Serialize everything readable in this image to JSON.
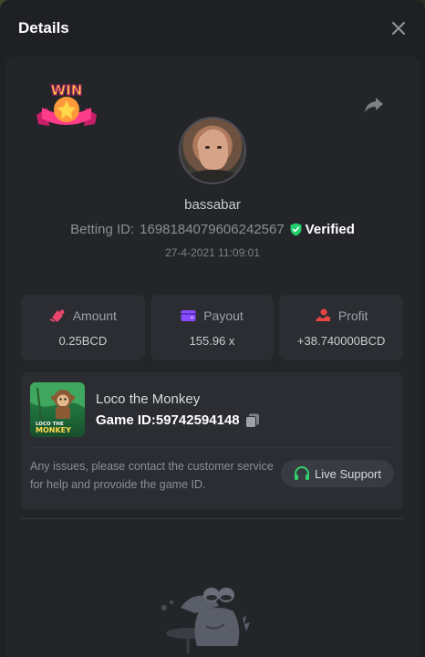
{
  "modal": {
    "title": "Details"
  },
  "player": {
    "username": "bassabar",
    "betting_id_label": "Betting ID:",
    "betting_id": "1698184079606242567",
    "verified_label": "Verified",
    "timestamp": "27-4-2021 11:09:01"
  },
  "badge": {
    "text": "WIN"
  },
  "stats": [
    {
      "label": "Amount",
      "value": "0.25BCD",
      "icon": "amount-icon",
      "color": "#e8466b"
    },
    {
      "label": "Payout",
      "value": "155.96 x",
      "icon": "wallet-icon",
      "color": "#8a4bff"
    },
    {
      "label": "Profit",
      "value": "+38.740000BCD",
      "icon": "profit-icon",
      "color": "#e84646"
    }
  ],
  "game": {
    "name": "Loco the Monkey",
    "id_label": "Game ID:",
    "id": "59742594148",
    "thumb_title_top": "LOCO THE",
    "thumb_title_bottom": "MONKEY"
  },
  "support": {
    "message": "Any issues, please contact the customer service for help and provoide the game ID.",
    "button_label": "Live Support"
  },
  "colors": {
    "verified": "#1fcf6b",
    "support_icon": "#31d16d",
    "background": "#1e2024"
  }
}
